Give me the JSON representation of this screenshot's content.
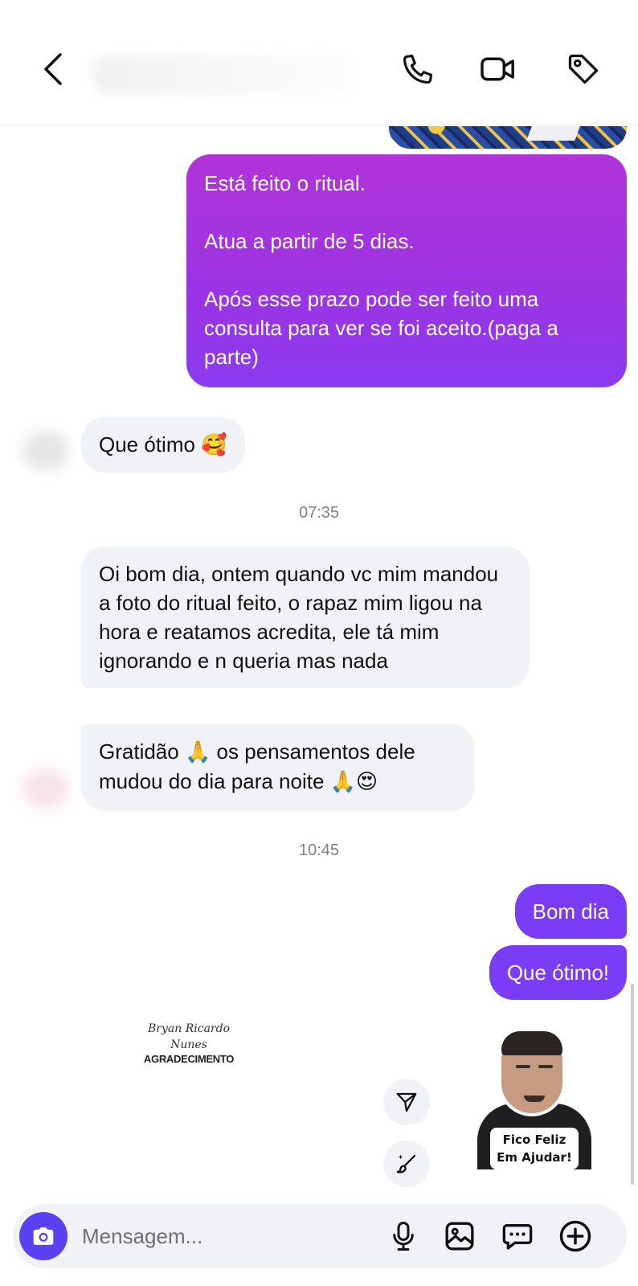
{
  "header": {
    "back_icon": "chevron-left-icon",
    "call_icon": "phone-icon",
    "video_icon": "video-camera-icon",
    "tag_icon": "tag-icon"
  },
  "messages": {
    "out1": "Está feito o ritual.\n\nAtua a partir de 5 dias.\n\nApós esse prazo pode ser feito uma consulta para ver se foi aceito.(paga a parte)",
    "in1_text": "Que ótimo ",
    "in1_emoji": "🥰",
    "time1": "07:35",
    "in2": "Oi bom dia, ontem quando vc mim mandou a foto do ritual feito, o rapaz mim ligou na hora e reatamos acredita, ele tá mim ignorando e n queria mas nada",
    "in3_part1": "Gratidão ",
    "in3_emoji1": "🙏",
    "in3_part2": " os pensamentos dele mudou do dia para noite ",
    "in3_emoji2": "🙏",
    "in3_emoji3": "😍",
    "time2": "10:45",
    "out2": "Bom dia",
    "out3": "Que ótimo!"
  },
  "watermark": {
    "name_line1": "Bryan Ricardo",
    "name_line2": "Nunes",
    "title": "AGRADECIMENTO"
  },
  "sticker": {
    "caption_line1": "Fico Feliz",
    "caption_line2": "Em Ajudar!"
  },
  "composer": {
    "placeholder": "Mensagem...",
    "camera_icon": "camera-icon",
    "mic_icon": "microphone-icon",
    "gallery_icon": "image-icon",
    "sticker_icon": "chat-bubble-icon",
    "plus_icon": "plus-circle-icon"
  },
  "colors": {
    "outgoing_gradient_top": "#b034d8",
    "outgoing_gradient_bottom": "#8b3bf0",
    "outgoing_blue": "#7b3cf6",
    "incoming": "#f0f2f5",
    "camera_button": "#5a42f2"
  }
}
